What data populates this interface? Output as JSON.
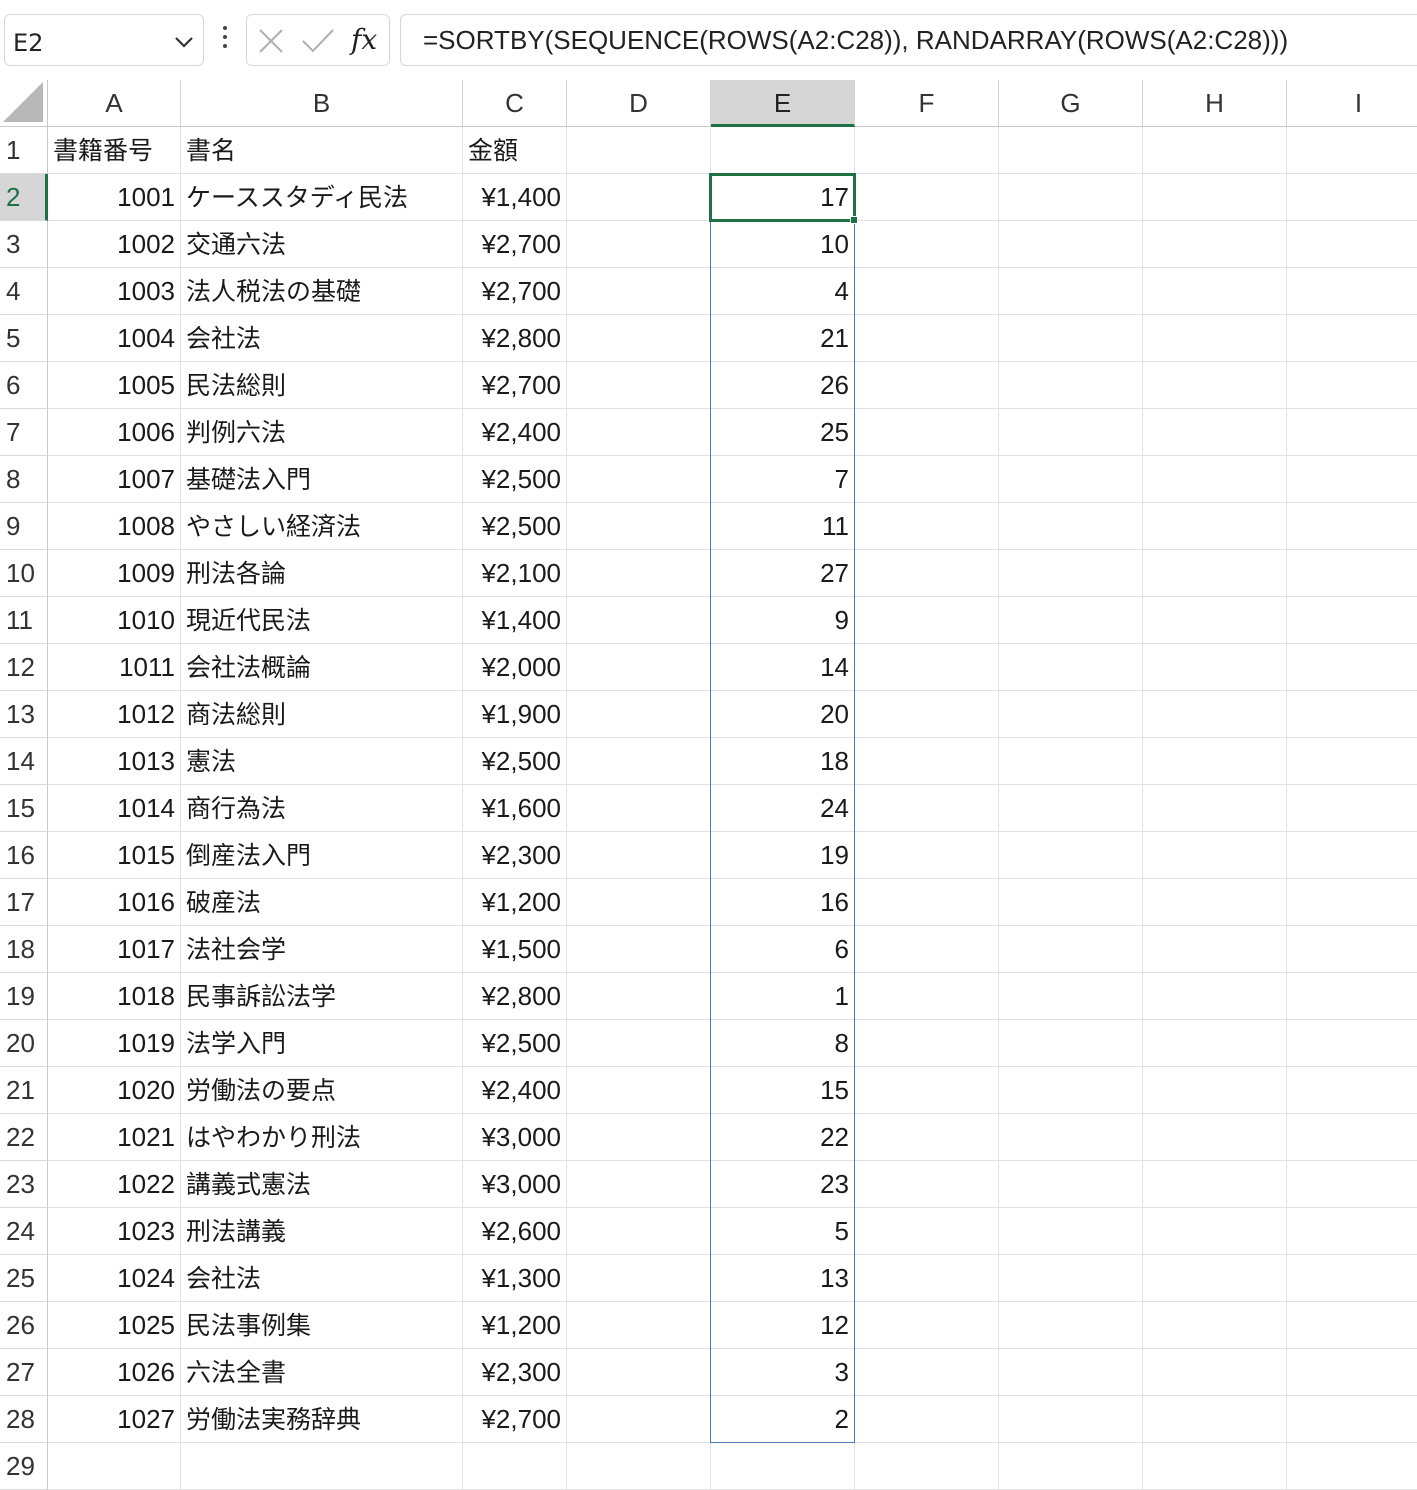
{
  "formula_bar": {
    "name_box": "E2",
    "fx_label": "fx",
    "formula": "=SORTBY(SEQUENCE(ROWS(A2:C28)), RANDARRAY(ROWS(A2:C28)))"
  },
  "columns": [
    "A",
    "B",
    "C",
    "D",
    "E",
    "F",
    "G",
    "H",
    "I"
  ],
  "selected_column": "E",
  "selected_row": "2",
  "row_numbers": [
    "1",
    "2",
    "3",
    "4",
    "5",
    "6",
    "7",
    "8",
    "9",
    "10",
    "11",
    "12",
    "13",
    "14",
    "15",
    "16",
    "17",
    "18",
    "19",
    "20",
    "21",
    "22",
    "23",
    "24",
    "25",
    "26",
    "27",
    "28",
    "29"
  ],
  "header_row": {
    "A": "書籍番号",
    "B": "書名",
    "C": "金額"
  },
  "rows": [
    {
      "id": "1001",
      "title": "ケーススタディ民法",
      "price": "¥1,400",
      "e": "17"
    },
    {
      "id": "1002",
      "title": "交通六法",
      "price": "¥2,700",
      "e": "10"
    },
    {
      "id": "1003",
      "title": "法人税法の基礎",
      "price": "¥2,700",
      "e": "4"
    },
    {
      "id": "1004",
      "title": "会社法",
      "price": "¥2,800",
      "e": "21"
    },
    {
      "id": "1005",
      "title": "民法総則",
      "price": "¥2,700",
      "e": "26"
    },
    {
      "id": "1006",
      "title": "判例六法",
      "price": "¥2,400",
      "e": "25"
    },
    {
      "id": "1007",
      "title": "基礎法入門",
      "price": "¥2,500",
      "e": "7"
    },
    {
      "id": "1008",
      "title": "やさしい経済法",
      "price": "¥2,500",
      "e": "11"
    },
    {
      "id": "1009",
      "title": "刑法各論",
      "price": "¥2,100",
      "e": "27"
    },
    {
      "id": "1010",
      "title": "現近代民法",
      "price": "¥1,400",
      "e": "9"
    },
    {
      "id": "1011",
      "title": "会社法概論",
      "price": "¥2,000",
      "e": "14"
    },
    {
      "id": "1012",
      "title": "商法総則",
      "price": "¥1,900",
      "e": "20"
    },
    {
      "id": "1013",
      "title": "憲法",
      "price": "¥2,500",
      "e": "18"
    },
    {
      "id": "1014",
      "title": "商行為法",
      "price": "¥1,600",
      "e": "24"
    },
    {
      "id": "1015",
      "title": "倒産法入門",
      "price": "¥2,300",
      "e": "19"
    },
    {
      "id": "1016",
      "title": "破産法",
      "price": "¥1,200",
      "e": "16"
    },
    {
      "id": "1017",
      "title": "法社会学",
      "price": "¥1,500",
      "e": "6"
    },
    {
      "id": "1018",
      "title": "民事訴訟法学",
      "price": "¥2,800",
      "e": "1"
    },
    {
      "id": "1019",
      "title": "法学入門",
      "price": "¥2,500",
      "e": "8"
    },
    {
      "id": "1020",
      "title": "労働法の要点",
      "price": "¥2,400",
      "e": "15"
    },
    {
      "id": "1021",
      "title": "はやわかり刑法",
      "price": "¥3,000",
      "e": "22"
    },
    {
      "id": "1022",
      "title": "講義式憲法",
      "price": "¥3,000",
      "e": "23"
    },
    {
      "id": "1023",
      "title": "刑法講義",
      "price": "¥2,600",
      "e": "5"
    },
    {
      "id": "1024",
      "title": "会社法",
      "price": "¥1,300",
      "e": "13"
    },
    {
      "id": "1025",
      "title": "民法事例集",
      "price": "¥1,200",
      "e": "12"
    },
    {
      "id": "1026",
      "title": "六法全書",
      "price": "¥2,300",
      "e": "3"
    },
    {
      "id": "1027",
      "title": "労働法実務辞典",
      "price": "¥2,700",
      "e": "2"
    }
  ],
  "icons": {
    "name_box_dropdown": "chevron-down-icon",
    "more": "more-vertical-icon",
    "cancel": "close-icon",
    "enter": "check-icon",
    "insert_function": "fx-icon"
  },
  "colors": {
    "selection_green": "#1e7145",
    "spill_blue": "#4a7ebb",
    "header_selected": "#d6d6d6"
  }
}
